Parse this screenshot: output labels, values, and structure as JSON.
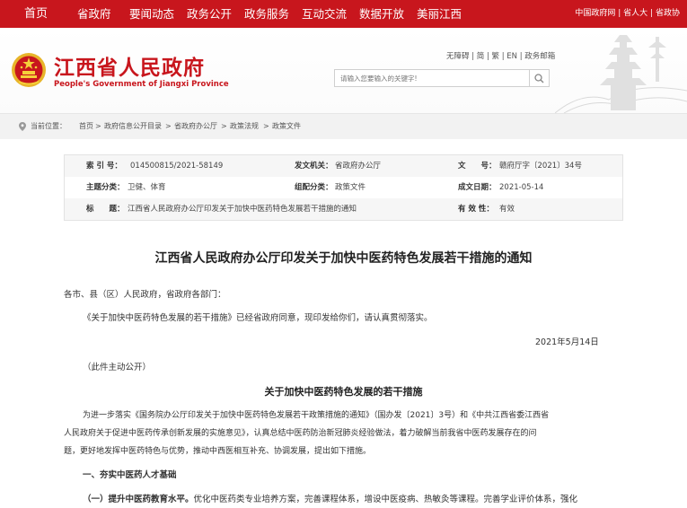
{
  "nav": {
    "items": [
      "首页",
      "省政府",
      "要闻动态",
      "政务公开",
      "政务服务",
      "互动交流",
      "数据开放",
      "美丽江西"
    ],
    "right_links": [
      "中国政府网",
      "省人大",
      "省政协"
    ],
    "separator": "|"
  },
  "header": {
    "title": "江西省人民政府",
    "subtitle": "People's Government of Jiangxi Province",
    "lang_links": "无障碍 | 简 | 繁 | EN | 政务邮箱",
    "search_placeholder": "请输入您要输入的关键字!"
  },
  "breadcrumb": {
    "label": "当前位置：",
    "items": [
      "首页",
      "政府信息公开目录",
      "省政府办公厅",
      "政策法规",
      "政策文件"
    ],
    "separator": ">"
  },
  "info": {
    "index_key": "索 引 号：",
    "index_val": "014500815/2021-58149",
    "issuer_key": "发文机关：",
    "issuer_val": "省政府办公厅",
    "docno_key": "文　　号：",
    "docno_val": "赣府厅字〔2021〕34号",
    "topic_key": "主题分类：",
    "topic_val": "卫健、体育",
    "form_key": "组配分类：",
    "form_val": "政策文件",
    "date_key": "成文日期：",
    "date_val": "2021-05-14",
    "title_key": "标　　题：",
    "title_val": "江西省人民政府办公厅印发关于加快中医药特色发展若干措施的通知",
    "validity_key": "有 效 性：",
    "validity_val": "有效"
  },
  "article": {
    "title": "江西省人民政府办公厅印发关于加快中医药特色发展若干措施的通知",
    "salutation": "各市、县（区）人民政府，省政府各部门：",
    "body1": "《关于加快中医药特色发展的若干措施》已经省政府同意，现印发给你们，请认真贯彻落实。",
    "date": "2021年5月14日",
    "public_note": "（此件主动公开）",
    "subtitle": "关于加快中医药特色发展的若干措施",
    "intro_line1": "为进一步落实《国务院办公厅印发关于加快中医药特色发展若干政策措施的通知》（国办发〔2021〕3号）和《中共江西省委江西省",
    "intro_line2": "人民政府关于促进中医药传承创新发展的实施意见》，认真总结中医药防治新冠肺炎经验做法，着力破解当前我省中医药发展存在的问",
    "intro_line3": "题，更好地发挥中医药特色与优势，推动中西医相互补充、协调发展，提出如下措施。",
    "section1": "一、夯实中医药人才基础",
    "item1_lead": "（一）提升中医药教育水平。",
    "item1_text": "优化中医药类专业培养方案，完善课程体系，增设中医疫病、热敏灸等课程。完善学业评价体系，强化"
  },
  "colors": {
    "brand_red": "#c8161d"
  }
}
